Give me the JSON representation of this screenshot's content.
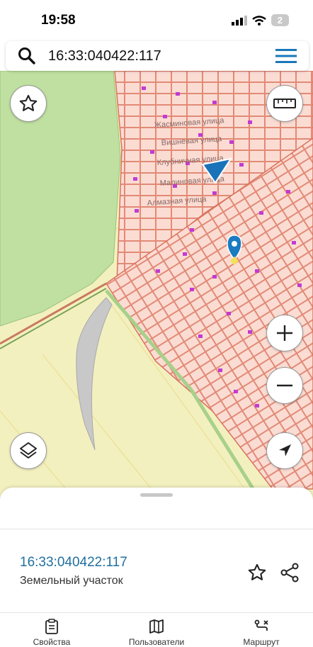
{
  "status": {
    "time": "19:58",
    "battery": "2"
  },
  "search": {
    "query": "16:33:040422:117"
  },
  "map": {
    "streets": [
      "Жасминовая улица",
      "Вишневая улица",
      "Клубничная улица",
      "Малиновая улица",
      "Алмазная улица"
    ],
    "colors": {
      "forest": "#bfe0a0",
      "field": "#f3f0bf",
      "parcel_fill": "#fbdcd3",
      "parcel_line": "#e28a76",
      "water": "#c8c8c8",
      "pin": "#1a7bc0"
    }
  },
  "parcel": {
    "id": "16:33:040422:117",
    "type": "Земельный участок"
  },
  "tabs": [
    {
      "label": "Свойства",
      "icon": "clipboard-icon"
    },
    {
      "label": "Пользователи",
      "icon": "map-icon"
    },
    {
      "label": "Маршрут",
      "icon": "route-icon"
    }
  ]
}
